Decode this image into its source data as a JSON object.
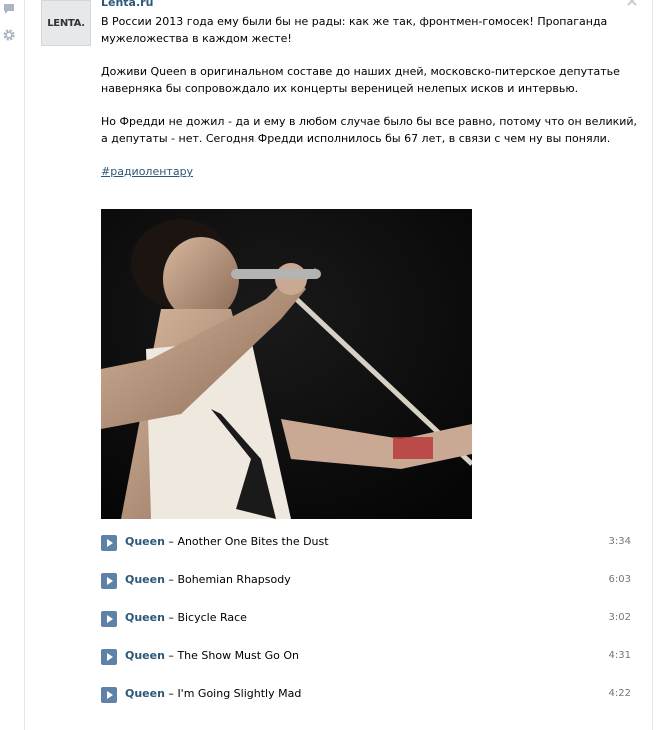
{
  "post": {
    "author": "Lenta.ru",
    "avatar_text": "LENTA.",
    "paragraphs": [
      "В России 2013 года ему были бы не рады: как же так, фронтмен-гомосек! Пропаганда мужеложества в каждом жесте!",
      "Доживи Queen в оригинальном составе до наших дней, московско-питерское депутатье наверняка бы сопровождало их концерты вереницей нелепых исков и интервью.",
      "Но Фредди не дожил - да и ему в любом случае было бы все равно, потому что он великий, а депутаты - нет. Сегодня Фредди исполнилось бы 67 лет, в связи с чем ну вы поняли."
    ],
    "hashtag": "#радиолентару"
  },
  "tracks": [
    {
      "artist": "Queen",
      "sep": " – ",
      "title": "Another One Bites the Dust",
      "duration": "3:34"
    },
    {
      "artist": "Queen",
      "sep": " – ",
      "title": "Bohemian Rhapsody",
      "duration": "6:03"
    },
    {
      "artist": "Queen",
      "sep": " – ",
      "title": "Bicycle Race",
      "duration": "3:02"
    },
    {
      "artist": "Queen",
      "sep": " – ",
      "title": "The Show Must Go On",
      "duration": "4:31"
    },
    {
      "artist": "Queen",
      "sep": " – ",
      "title": "I'm Going Slightly Mad",
      "duration": "4:22"
    }
  ],
  "icons": {
    "comment": "comment-icon",
    "settings": "gear-icon",
    "close": "close-icon",
    "play": "play-icon"
  },
  "colors": {
    "link": "#2b587a",
    "play_button": "#5e82a8",
    "duration_text": "#777777"
  }
}
